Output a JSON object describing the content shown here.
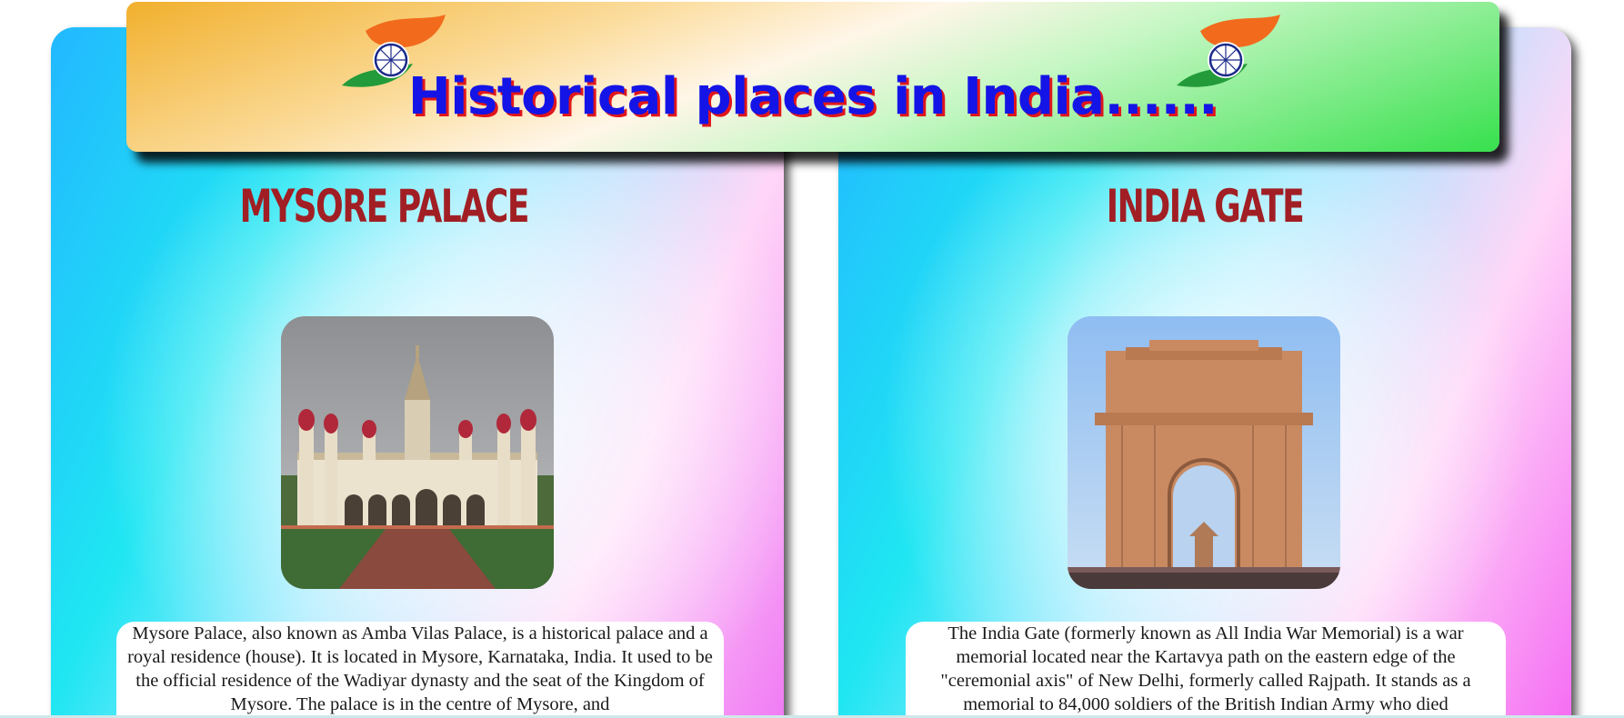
{
  "header": {
    "title": "Historical places in India......"
  },
  "cards": [
    {
      "title": "MYSORE PALACE",
      "image_alt": "Mysore Palace",
      "description": "Mysore Palace, also known as Amba Vilas Palace, is a historical palace and a royal residence (house). It is located in Mysore, Karnataka, India. It used to be the official residence of the Wadiyar dynasty and the seat of the Kingdom of Mysore. The palace is in the centre of Mysore, and"
    },
    {
      "title": "INDIA GATE",
      "image_alt": "India Gate",
      "description": "The India Gate (formerly known as All India War Memorial) is a war memorial located near the Kartavya path on the eastern edge of the \"ceremonial axis\" of New Delhi, formerly called Rajpath. It stands as a memorial to 84,000 soldiers of the British Indian Army who died"
    }
  ],
  "colors": {
    "header_title": "#1414e6",
    "header_title_shadow": "#e0161c",
    "card_title": "#a11f24"
  }
}
